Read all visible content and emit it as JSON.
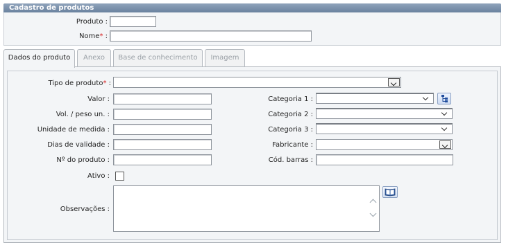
{
  "header": {
    "title": "Cadastro de produtos"
  },
  "top_form": {
    "produto_label": "Produto :",
    "produto_value": "",
    "nome_label": "Nome",
    "nome_required": "*",
    "nome_suffix": " :",
    "nome_value": ""
  },
  "tabs": [
    {
      "label": "Dados do produto",
      "active": true
    },
    {
      "label": "Anexo",
      "active": false
    },
    {
      "label": "Base de conhecimento",
      "active": false
    },
    {
      "label": "Imagem",
      "active": false
    }
  ],
  "form": {
    "tipo_label": "Tipo de produto",
    "tipo_required": "*",
    "tipo_suffix": " :",
    "tipo_value": "",
    "valor_label": "Valor :",
    "vol_label": "Vol. / peso un. :",
    "unidade_label": "Unidade de medida :",
    "dias_label": "Dias de validade :",
    "numero_label": "Nº do produto :",
    "ativo_label": "Ativo :",
    "ativo_checked": false,
    "obs_label": "Observações :",
    "obs_value": "",
    "cat1_label": "Categoria 1 :",
    "cat2_label": "Categoria 2 :",
    "cat3_label": "Categoria 3 :",
    "fabricante_label": "Fabricante :",
    "codbarras_label": "Cód. barras :"
  },
  "icons": {
    "category_tree": "tree-icon",
    "obs_book": "book-icon",
    "dropdown": "chevron-down-icon"
  },
  "colors": {
    "header_bg": "#7e93ad",
    "required_marker": "#d61c1c",
    "panel_bg": "#f3f5f7",
    "inactive_tab_text": "#9aa0a6"
  }
}
